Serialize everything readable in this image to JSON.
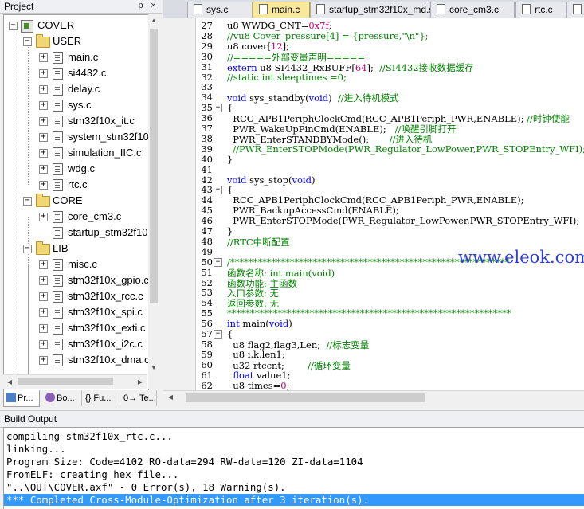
{
  "project_panel": {
    "title": "Project",
    "pin_glyph": "ᵽ",
    "close_glyph": "×",
    "tree": [
      {
        "label": "COVER",
        "kind": "root",
        "expander": "−"
      },
      {
        "label": "USER",
        "kind": "folder",
        "expander": "−"
      },
      {
        "label": "main.c",
        "kind": "file",
        "expander": "+"
      },
      {
        "label": "si4432.c",
        "kind": "file",
        "expander": "+"
      },
      {
        "label": "delay.c",
        "kind": "file",
        "expander": "+"
      },
      {
        "label": "sys.c",
        "kind": "file",
        "expander": "+"
      },
      {
        "label": "stm32f10x_it.c",
        "kind": "file",
        "expander": "+"
      },
      {
        "label": "system_stm32f10",
        "kind": "file",
        "expander": "+"
      },
      {
        "label": "simulation_IIC.c",
        "kind": "file",
        "expander": "+"
      },
      {
        "label": "wdg.c",
        "kind": "file",
        "expander": "+"
      },
      {
        "label": "rtc.c",
        "kind": "file",
        "expander": "+"
      },
      {
        "label": "CORE",
        "kind": "folder",
        "expander": "−"
      },
      {
        "label": "core_cm3.c",
        "kind": "file",
        "expander": "+"
      },
      {
        "label": "startup_stm32f10",
        "kind": "file",
        "expander": ""
      },
      {
        "label": "LIB",
        "kind": "folder",
        "expander": "−"
      },
      {
        "label": "misc.c",
        "kind": "file",
        "expander": "+"
      },
      {
        "label": "stm32f10x_gpio.c",
        "kind": "file",
        "expander": "+"
      },
      {
        "label": "stm32f10x_rcc.c",
        "kind": "file",
        "expander": "+"
      },
      {
        "label": "stm32f10x_spi.c",
        "kind": "file",
        "expander": "+"
      },
      {
        "label": "stm32f10x_exti.c",
        "kind": "file",
        "expander": "+"
      },
      {
        "label": "stm32f10x_i2c.c",
        "kind": "file",
        "expander": "+"
      },
      {
        "label": "stm32f10x_dma.c",
        "kind": "file",
        "expander": "+"
      }
    ],
    "bottom_tabs": [
      {
        "label": "Pr...",
        "icon": "project-icon",
        "active": true
      },
      {
        "label": "Bo...",
        "icon": "books-icon",
        "active": false
      },
      {
        "label": "{} Fu...",
        "icon": "functions-icon",
        "active": false
      },
      {
        "label": "0→ Te...",
        "icon": "templates-icon",
        "active": false
      }
    ]
  },
  "editor": {
    "tabs": [
      {
        "label": "sys.c",
        "active": false
      },
      {
        "label": "main.c",
        "active": true
      },
      {
        "label": "startup_stm32f10x_md.s",
        "active": false
      },
      {
        "label": "core_cm3.c",
        "active": false
      },
      {
        "label": "rtc.c",
        "active": false
      },
      {
        "label": "v",
        "active": false
      }
    ],
    "lines": [
      {
        "n": "27",
        "fold": "",
        "parts": [
          [
            "t",
            "u8 WWDG_CNT="
          ],
          [
            "n",
            "0x7f"
          ],
          [
            "t",
            ";"
          ]
        ]
      },
      {
        "n": "28",
        "fold": "",
        "parts": [
          [
            "c",
            "//vu8 Cover_pressure[4] = {pressure,\"\\n\"};"
          ]
        ]
      },
      {
        "n": "29",
        "fold": "",
        "parts": [
          [
            "t",
            "u8 cover["
          ],
          [
            "n",
            "12"
          ],
          [
            "t",
            "];"
          ]
        ]
      },
      {
        "n": "30",
        "fold": "",
        "parts": [
          [
            "c",
            "//=====外部变量声明====="
          ]
        ]
      },
      {
        "n": "31",
        "fold": "",
        "parts": [
          [
            "k",
            "extern"
          ],
          [
            "t",
            " u8 SI4432_RxBUFF["
          ],
          [
            "n",
            "64"
          ],
          [
            "t",
            "];  "
          ],
          [
            "c",
            "//SI4432接收数据缓存"
          ]
        ]
      },
      {
        "n": "32",
        "fold": "",
        "parts": [
          [
            "c",
            "//static int sleeptimes =0;"
          ]
        ]
      },
      {
        "n": "33",
        "fold": "",
        "parts": [
          [
            "t",
            ""
          ]
        ]
      },
      {
        "n": "34",
        "fold": "",
        "parts": [
          [
            "k",
            "void"
          ],
          [
            "t",
            " sys_standby("
          ],
          [
            "k",
            "void"
          ],
          [
            "t",
            ")  "
          ],
          [
            "c",
            "//进入待机模式"
          ]
        ]
      },
      {
        "n": "35",
        "fold": "−",
        "parts": [
          [
            "t",
            "{"
          ]
        ]
      },
      {
        "n": "36",
        "fold": "",
        "parts": [
          [
            "t",
            "  RCC_APB1PeriphClockCmd(RCC_APB1Periph_PWR,ENABLE); "
          ],
          [
            "c",
            "//时钟使能"
          ]
        ]
      },
      {
        "n": "37",
        "fold": "",
        "parts": [
          [
            "t",
            "  PWR_WakeUpPinCmd(ENABLE);   "
          ],
          [
            "c",
            "//唤醒引脚打开"
          ]
        ]
      },
      {
        "n": "38",
        "fold": "",
        "parts": [
          [
            "t",
            "  PWR_EnterSTANDBYMode();       "
          ],
          [
            "c",
            "//进入待机"
          ]
        ]
      },
      {
        "n": "39",
        "fold": "",
        "parts": [
          [
            "c",
            "  //PWR_EnterSTOPMode(PWR_Regulator_LowPower,PWR_STOPEntry_WFI);"
          ]
        ]
      },
      {
        "n": "40",
        "fold": "",
        "parts": [
          [
            "t",
            "}"
          ]
        ]
      },
      {
        "n": "41",
        "fold": "",
        "parts": [
          [
            "t",
            ""
          ]
        ]
      },
      {
        "n": "42",
        "fold": "",
        "parts": [
          [
            "k",
            "void"
          ],
          [
            "t",
            " sys_stop("
          ],
          [
            "k",
            "void"
          ],
          [
            "t",
            ")"
          ]
        ]
      },
      {
        "n": "43",
        "fold": "−",
        "parts": [
          [
            "t",
            "{"
          ]
        ]
      },
      {
        "n": "44",
        "fold": "",
        "parts": [
          [
            "t",
            "  RCC_APB1PeriphClockCmd(RCC_APB1Periph_PWR,ENABLE);"
          ]
        ]
      },
      {
        "n": "45",
        "fold": "",
        "parts": [
          [
            "t",
            "  PWR_BackupAccessCmd(ENABLE);"
          ]
        ]
      },
      {
        "n": "46",
        "fold": "",
        "parts": [
          [
            "t",
            "  PWR_EnterSTOPMode(PWR_Regulator_LowPower,PWR_STOPEntry_WFI);"
          ]
        ]
      },
      {
        "n": "47",
        "fold": "",
        "parts": [
          [
            "t",
            "}"
          ]
        ]
      },
      {
        "n": "48",
        "fold": "",
        "parts": [
          [
            "c",
            "//RTC中断配置"
          ]
        ]
      },
      {
        "n": "49",
        "fold": "",
        "parts": [
          [
            "t",
            ""
          ]
        ]
      },
      {
        "n": "50",
        "fold": "−",
        "parts": [
          [
            "c",
            "/*************************************************************"
          ]
        ]
      },
      {
        "n": "51",
        "fold": "",
        "parts": [
          [
            "c",
            "函数名称: int main(void)"
          ]
        ]
      },
      {
        "n": "52",
        "fold": "",
        "parts": [
          [
            "c",
            "函数功能: 主函数"
          ]
        ]
      },
      {
        "n": "53",
        "fold": "",
        "parts": [
          [
            "c",
            "入口参数: 无"
          ]
        ]
      },
      {
        "n": "54",
        "fold": "",
        "parts": [
          [
            "c",
            "返回参数: 无"
          ]
        ]
      },
      {
        "n": "55",
        "fold": "",
        "parts": [
          [
            "c",
            "**************************************************************"
          ]
        ]
      },
      {
        "n": "56",
        "fold": "",
        "parts": [
          [
            "k",
            "int"
          ],
          [
            "t",
            " main("
          ],
          [
            "k",
            "void"
          ],
          [
            "t",
            ")"
          ]
        ]
      },
      {
        "n": "57",
        "fold": "−",
        "parts": [
          [
            "t",
            "{"
          ]
        ]
      },
      {
        "n": "58",
        "fold": "",
        "parts": [
          [
            "t",
            "  u8 flag2,flag3,Len;  "
          ],
          [
            "c",
            "//标志变量"
          ]
        ]
      },
      {
        "n": "59",
        "fold": "",
        "parts": [
          [
            "t",
            "  u8 i,k,len1;"
          ]
        ]
      },
      {
        "n": "60",
        "fold": "",
        "parts": [
          [
            "t",
            "  u32 rtccnt;        "
          ],
          [
            "c",
            "//循环变量"
          ]
        ]
      },
      {
        "n": "61",
        "fold": "",
        "parts": [
          [
            "t",
            "  "
          ],
          [
            "k",
            "float"
          ],
          [
            "t",
            " value1;"
          ]
        ]
      },
      {
        "n": "62",
        "fold": "",
        "parts": [
          [
            "t",
            "  u8 times="
          ],
          [
            "n",
            "0"
          ],
          [
            "t",
            ";"
          ]
        ]
      }
    ],
    "watermark": "www.eleok.com"
  },
  "build_output": {
    "title": "Build Output",
    "lines": [
      "compiling stm32f10x_rtc.c...",
      "linking...",
      "Program Size: Code=4102 RO-data=294 RW-data=120 ZI-data=1104",
      "FromELF: creating hex file...",
      "\"..\\OUT\\COVER.axf\" - 0 Error(s), 18 Warning(s).",
      "*** Completed Cross-Module-Optimization after 3 iteration(s)."
    ],
    "selected_line": 5
  },
  "colors": {
    "keyword": "#0000ff",
    "comment": "#008000",
    "number": "#c0006f",
    "active_tab": "#f8e89c",
    "selection": "#3399ff",
    "watermark": "#2f3fd6"
  }
}
